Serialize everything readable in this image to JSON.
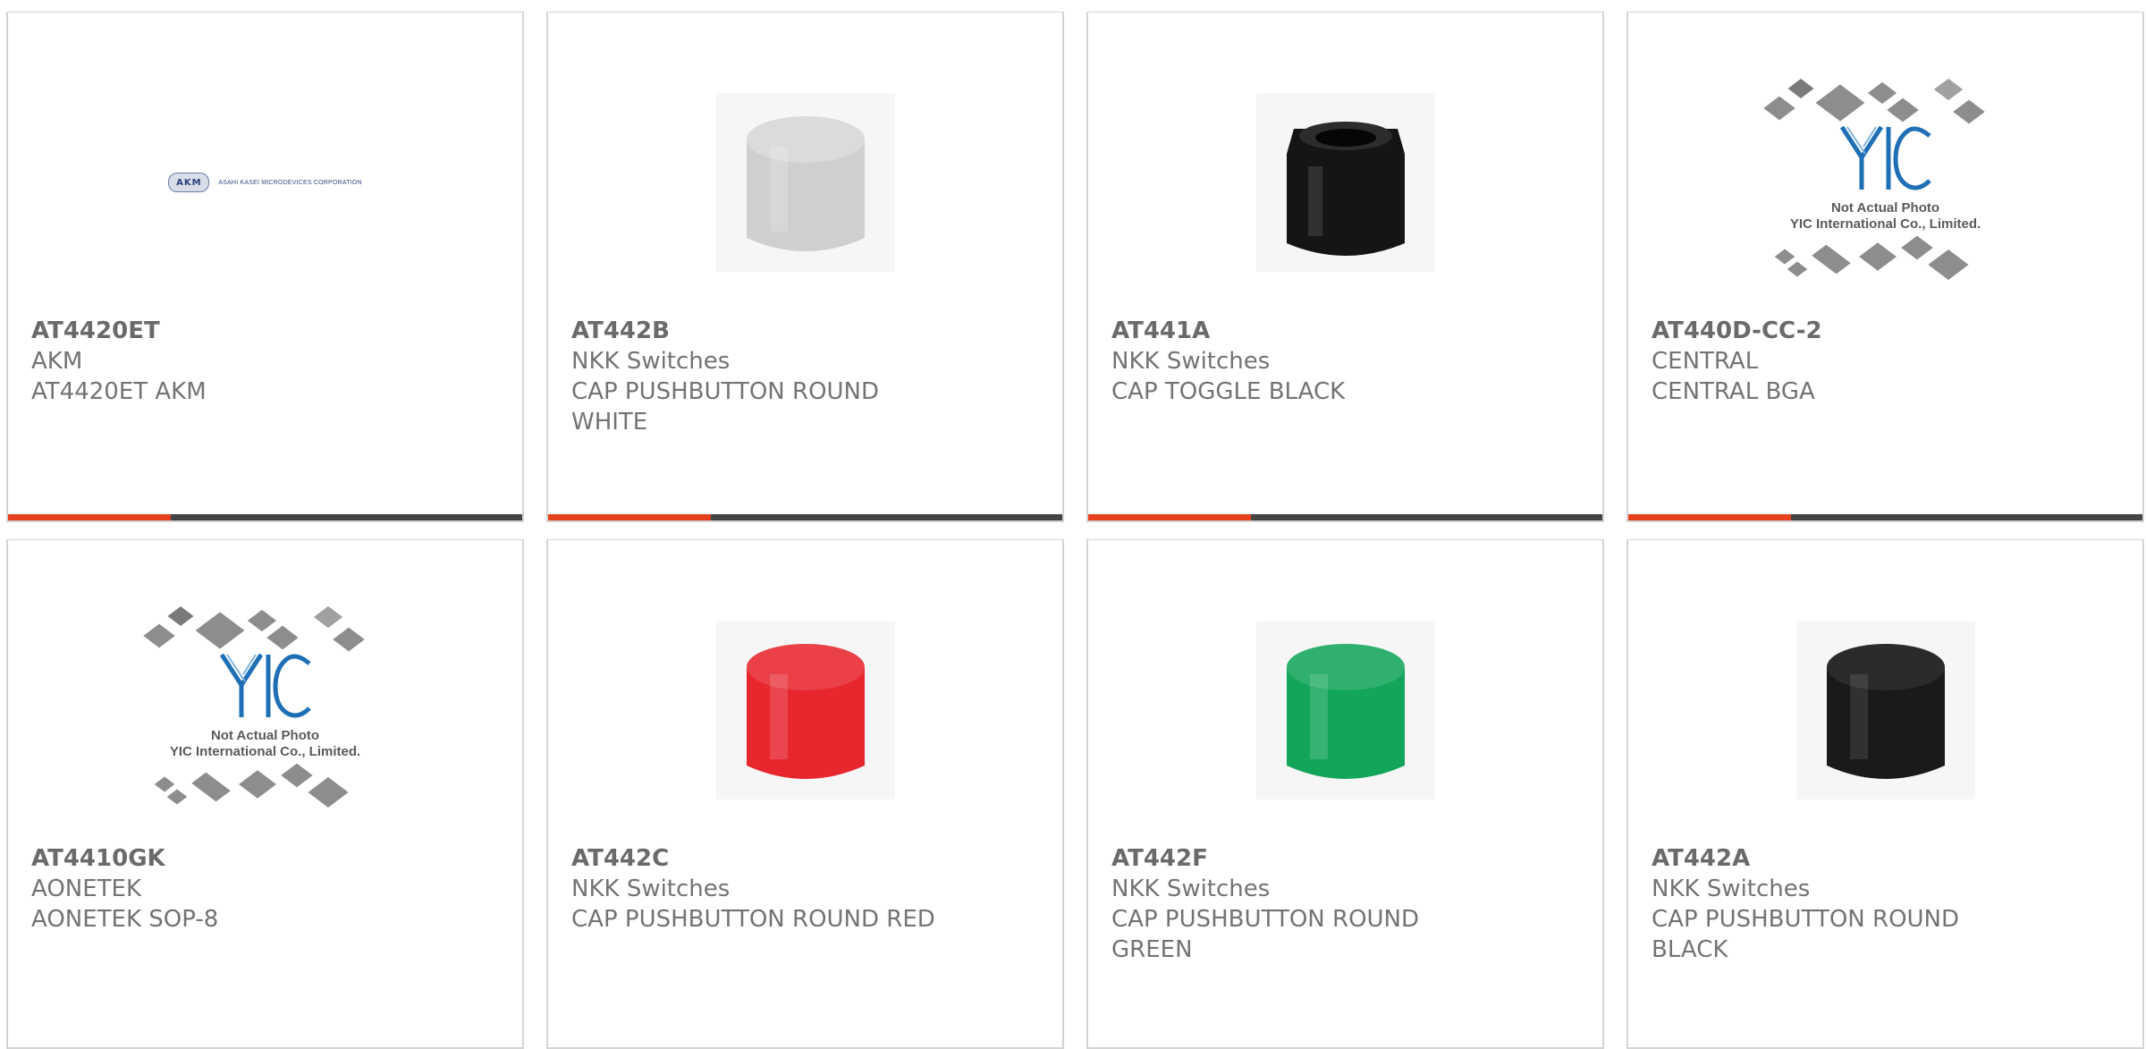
{
  "colors": {
    "accent_orange": "#e8401c",
    "accent_gray": "#444444",
    "border": "#d4d4d4",
    "text": "#737373"
  },
  "products": [
    {
      "part": "AT4420ET",
      "manufacturer": "AKM",
      "description": [
        "AT4420ET AKM"
      ],
      "image": "akm-logo",
      "logo_text": "AKM",
      "logo_subtext": "ASAHI KASEI MICRODEVICES CORPORATION"
    },
    {
      "part": "AT442B",
      "manufacturer": "NKK Switches",
      "description": [
        "CAP PUSHBUTTON ROUND",
        "WHITE"
      ],
      "image": "cap-icon",
      "cap_color": "#cfcfcf"
    },
    {
      "part": "AT441A",
      "manufacturer": "NKK Switches",
      "description": [
        "CAP TOGGLE BLACK"
      ],
      "image": "toggle-cap-icon",
      "cap_color": "#151515"
    },
    {
      "part": "AT440D-CC-2",
      "manufacturer": "CENTRAL",
      "description": [
        "CENTRAL BGA"
      ],
      "image": "placeholder",
      "placeholder_lines": [
        "Not Actual Photo",
        "YIC International Co., Limited."
      ]
    },
    {
      "part": "AT4410GK",
      "manufacturer": "AONETEK",
      "description": [
        "AONETEK SOP-8"
      ],
      "image": "placeholder",
      "placeholder_lines": [
        "Not Actual Photo",
        "YIC International Co., Limited."
      ]
    },
    {
      "part": "AT442C",
      "manufacturer": "NKK Switches",
      "description": [
        "CAP PUSHBUTTON ROUND RED"
      ],
      "image": "cap-icon",
      "cap_color": "#e8262e"
    },
    {
      "part": "AT442F",
      "manufacturer": "NKK Switches",
      "description": [
        "CAP PUSHBUTTON ROUND",
        "GREEN"
      ],
      "image": "cap-icon",
      "cap_color": "#13a55a"
    },
    {
      "part": "AT442A",
      "manufacturer": "NKK Switches",
      "description": [
        "CAP PUSHBUTTON ROUND",
        "BLACK"
      ],
      "image": "cap-icon",
      "cap_color": "#1a1a1a"
    }
  ]
}
